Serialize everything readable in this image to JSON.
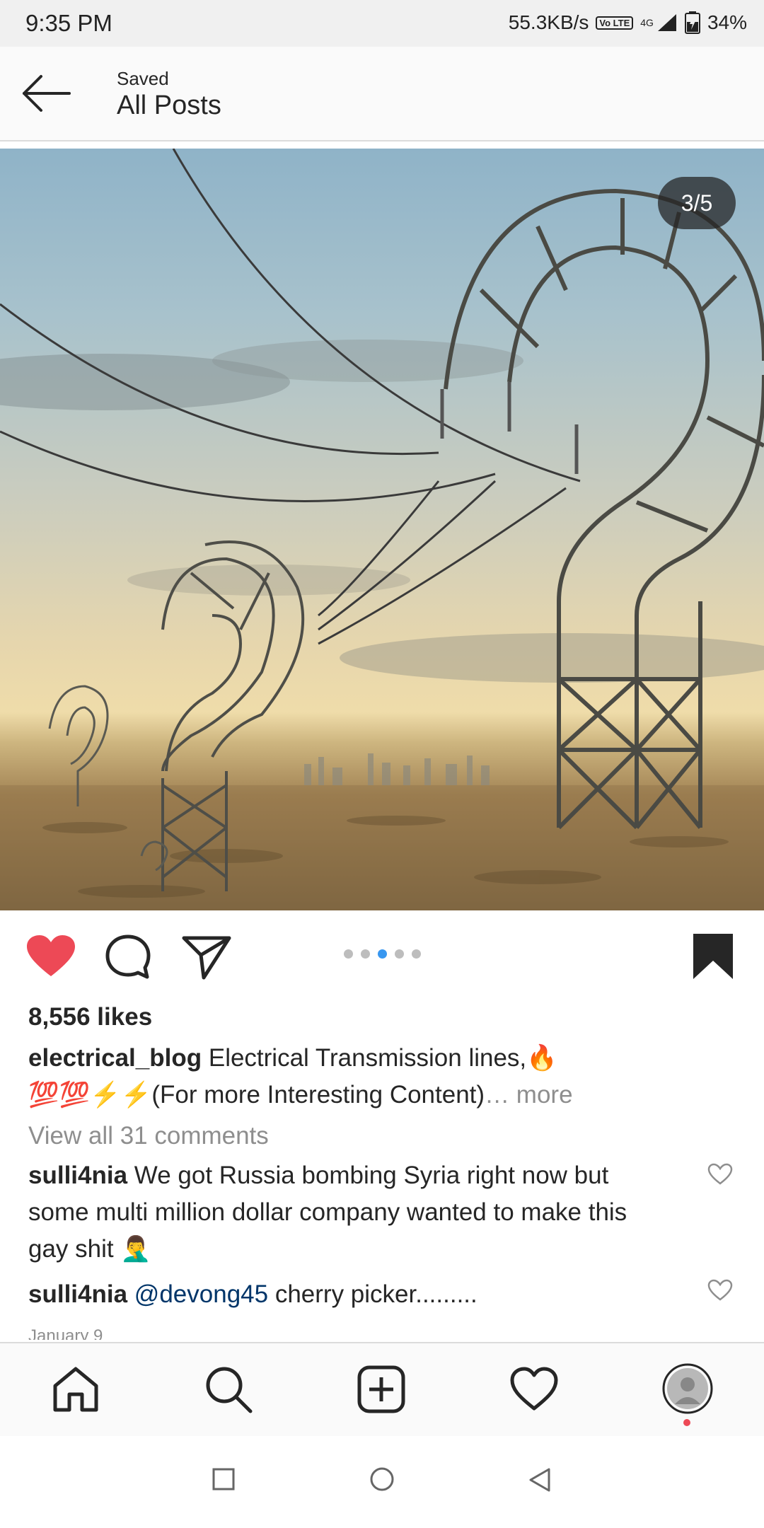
{
  "status_bar": {
    "time": "9:35 PM",
    "speed": "55.3KB/s",
    "volte": "Vo LTE",
    "network": "4G",
    "battery": "34%"
  },
  "header": {
    "subtitle": "Saved",
    "title": "All Posts"
  },
  "post": {
    "carousel_counter": "3/5",
    "carousel_total": 5,
    "carousel_active": 3,
    "liked": true,
    "saved": true,
    "likes": "8,556 likes",
    "author": "electrical_blog",
    "caption_line1": "Electrical Transmission lines,🔥",
    "caption_line2": "💯💯⚡⚡(For more Interesting Content)",
    "more_label": "… more",
    "view_all": "View all 31 comments",
    "comments": [
      {
        "user": "sulli4nia",
        "text": "We got Russia bombing Syria right now but some multi million dollar company wanted to make this gay shit 🤦‍♂️"
      },
      {
        "user": "sulli4nia",
        "mention": "@devong45",
        "text": "cherry picker........."
      }
    ],
    "date": "January 9"
  },
  "colors": {
    "like_red": "#ed4956",
    "active_dot": "#3897f0",
    "mention": "#003569"
  },
  "icons": {
    "back": "arrow-left-icon",
    "like": "heart-filled-icon",
    "comment": "comment-bubble-icon",
    "share": "paper-plane-icon",
    "save": "bookmark-filled-icon",
    "nav": [
      "home-icon",
      "search-icon",
      "add-post-icon",
      "activity-heart-icon",
      "profile-avatar"
    ],
    "system": [
      "recents-square-icon",
      "home-circle-icon",
      "back-triangle-icon"
    ]
  }
}
